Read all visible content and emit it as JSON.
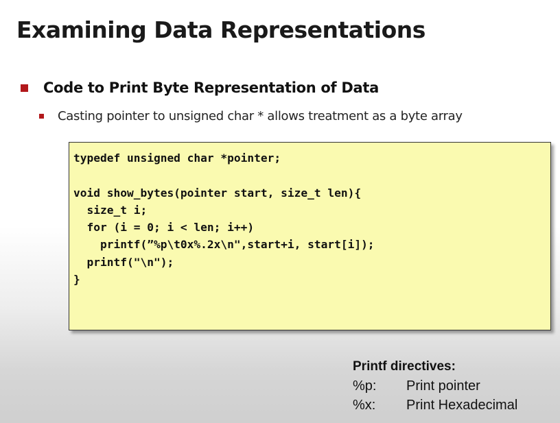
{
  "slide": {
    "title": "Examining Data Representations",
    "bullet1": "Code to Print Byte Representation of Data",
    "bullet2": "Casting pointer to unsigned char * allows treatment as a byte array"
  },
  "code": {
    "lines": [
      "typedef unsigned char *pointer;",
      "",
      "void show_bytes(pointer start, size_t len){",
      "  size_t i;",
      "  for (i = 0; i < len; i++)",
      "    printf(”%p\\t0x%.2x\\n\",start+i, start[i]);",
      "  printf(\"\\n\");",
      "}"
    ]
  },
  "directives": {
    "title": "Printf directives:",
    "items": [
      {
        "code": "%p:",
        "desc": "Print pointer"
      },
      {
        "code": "%x:",
        "desc": "Print Hexadecimal"
      }
    ]
  },
  "colors": {
    "bullet": "#b2181b",
    "code_background": "#fafab0"
  }
}
